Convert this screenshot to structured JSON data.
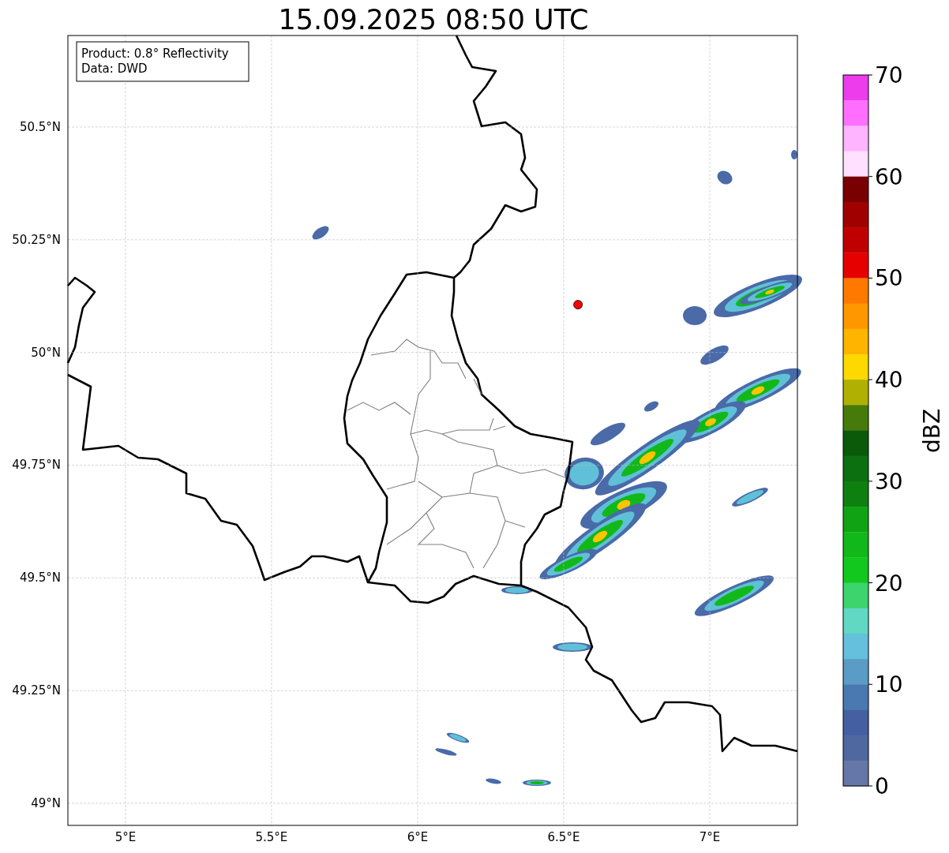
{
  "title": "15.09.2025 08:50 UTC",
  "info_box": [
    "Product: 0.8° Reflectivity",
    "Data: DWD"
  ],
  "map": {
    "chart_data": {
      "type": "scatter",
      "xlim": [
        4.803,
        7.3
      ],
      "ylim": [
        48.951,
        50.703
      ],
      "xticks": [
        {
          "value": 5,
          "label": "5°E"
        },
        {
          "value": 5.5,
          "label": "5.5°E"
        },
        {
          "value": 6,
          "label": "6°E"
        },
        {
          "value": 6.5,
          "label": "6.5°E"
        },
        {
          "value": 7,
          "label": "7°E"
        }
      ],
      "yticks": [
        {
          "value": 49,
          "label": "49°N"
        },
        {
          "value": 49.25,
          "label": "49.25°N"
        },
        {
          "value": 49.5,
          "label": "49.5°N"
        },
        {
          "value": 49.75,
          "label": "49.75°N"
        },
        {
          "value": 50,
          "label": "50°N"
        },
        {
          "value": 50.25,
          "label": "50.25°N"
        },
        {
          "value": 50.5,
          "label": "50.5°N"
        }
      ],
      "x": [
        6.549
      ],
      "grid": true,
      "series": [
        {
          "color": "#ff0000",
          "values": [
            50.106
          ]
        }
      ]
    }
  },
  "colorbar": {
    "label": "dBZ",
    "ticks": [
      "70",
      "60",
      "50",
      "40",
      "30",
      "20",
      "10",
      "0"
    ],
    "bands": [
      {
        "color": "#ec3cec"
      },
      {
        "color": "#ff6eff"
      },
      {
        "color": "#ffb4ff"
      },
      {
        "color": "#ffe0ff"
      },
      {
        "color": "#780000"
      },
      {
        "color": "#a00000"
      },
      {
        "color": "#c00000"
      },
      {
        "color": "#e60000"
      },
      {
        "color": "#ff7800"
      },
      {
        "color": "#ff9800"
      },
      {
        "color": "#ffb400"
      },
      {
        "color": "#ffd800"
      },
      {
        "color": "#b0b000"
      },
      {
        "color": "#467a0a"
      },
      {
        "color": "#0a5a0a"
      },
      {
        "color": "#0c7010"
      },
      {
        "color": "#0e8010"
      },
      {
        "color": "#10a414"
      },
      {
        "color": "#12b81a"
      },
      {
        "color": "#12c81e"
      },
      {
        "color": "#3cd46c"
      },
      {
        "color": "#60d8c4"
      },
      {
        "color": "#64c0dc"
      },
      {
        "color": "#5a9cc6"
      },
      {
        "color": "#4a78b0"
      },
      {
        "color": "#4460a2"
      },
      {
        "color": "#5068a0"
      },
      {
        "color": "#6577a8"
      }
    ]
  }
}
